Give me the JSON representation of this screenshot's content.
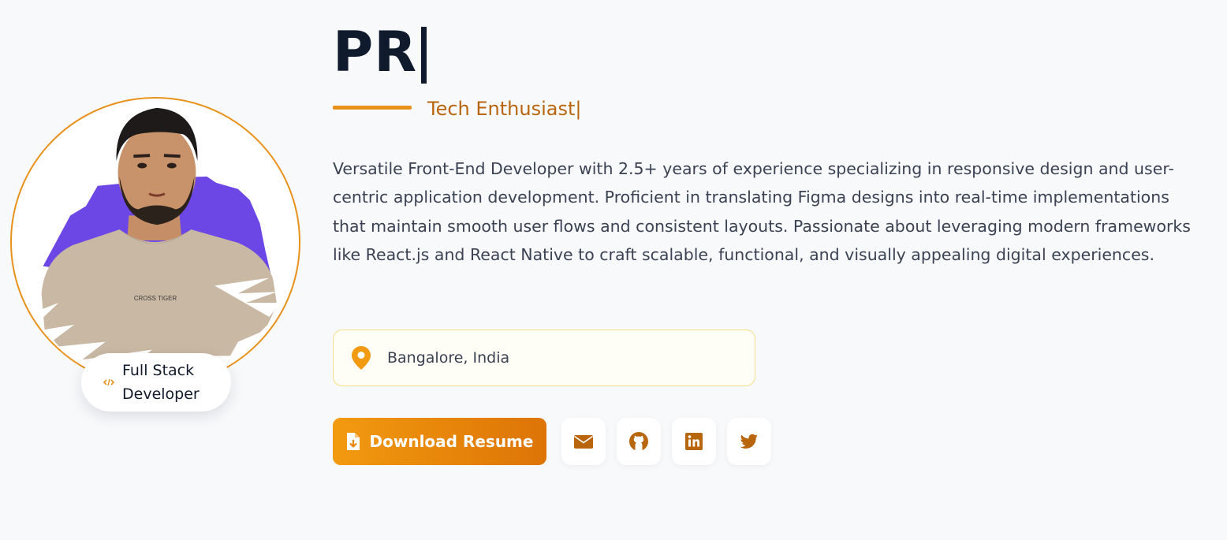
{
  "profile": {
    "name": "PR",
    "tagline": "Tech Enthusiast|",
    "bio": "Versatile Front-End Developer with 2.5+ years of experience specializing in responsive design and user-centric application development. Proficient in translating Figma designs into real-time implementations that maintain smooth user flows and consistent layouts. Passionate about leveraging modern frameworks like React.js and React Native to craft scalable, functional, and visually appealing digital experiences.",
    "location": "Bangalore, India",
    "role_badge": "Full Stack Developer",
    "shirt_text": "CROSS TIGER"
  },
  "actions": {
    "resume_label": "Download Resume"
  },
  "icons": {
    "role": "code-icon",
    "location": "map-pin-icon",
    "resume": "file-download-icon",
    "social": [
      "envelope-icon",
      "github-icon",
      "linkedin-icon",
      "twitter-icon"
    ]
  },
  "colors": {
    "accent": "#e8911b",
    "accent_dark": "#b8650d",
    "brush": "#6c47e6",
    "name": "#0f1b2d",
    "background": "#f8f9fb"
  }
}
